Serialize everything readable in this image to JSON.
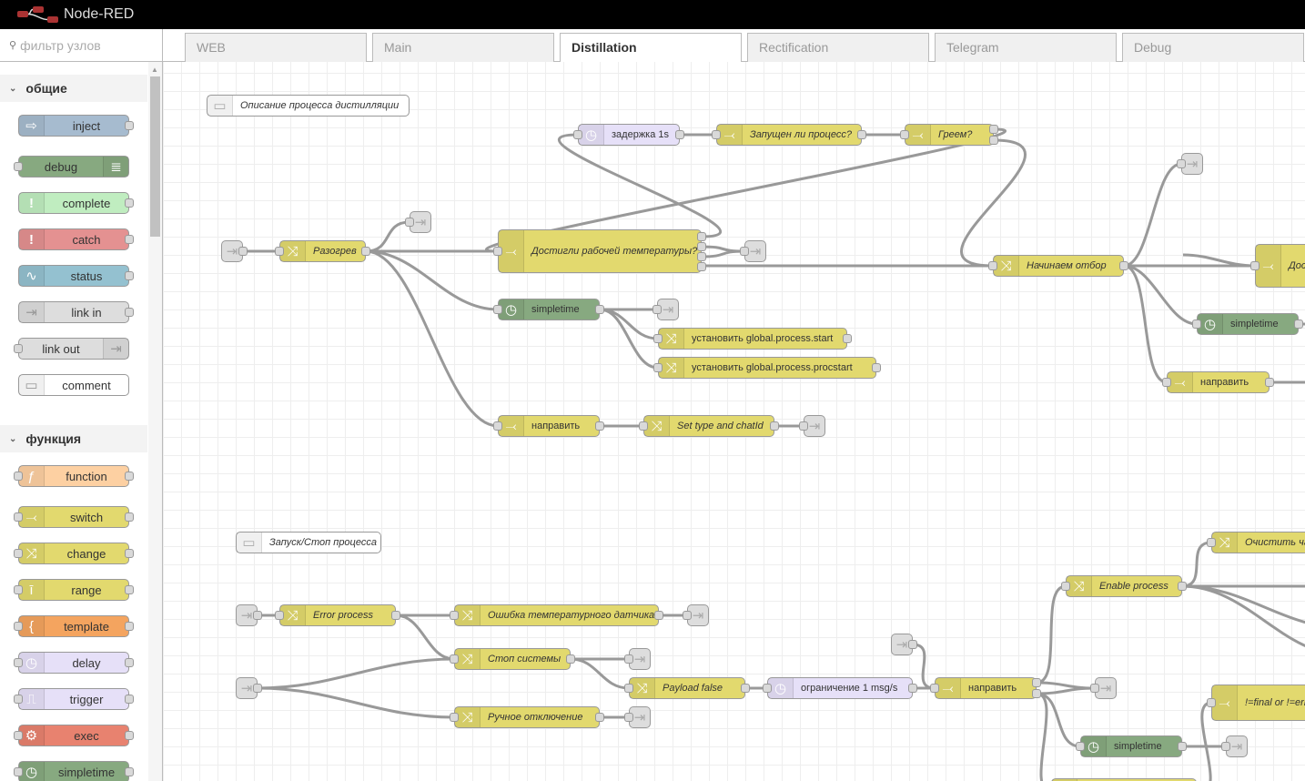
{
  "header": {
    "title": "Node-RED",
    "logo_icon": "node-red-logo"
  },
  "palette": {
    "filter_placeholder": "фильтр узлов",
    "categories": [
      {
        "title": "общие",
        "nodes": [
          {
            "label": "inject",
            "type": "inject"
          },
          {
            "label": "debug",
            "type": "debug"
          },
          {
            "label": "complete",
            "type": "complete"
          },
          {
            "label": "catch",
            "type": "catch"
          },
          {
            "label": "status",
            "type": "status"
          },
          {
            "label": "link in",
            "type": "linkin"
          },
          {
            "label": "link out",
            "type": "linkout"
          },
          {
            "label": "comment",
            "type": "comment"
          }
        ]
      },
      {
        "title": "функция",
        "nodes": [
          {
            "label": "function",
            "type": "function"
          },
          {
            "label": "switch",
            "type": "switch"
          },
          {
            "label": "change",
            "type": "change"
          },
          {
            "label": "range",
            "type": "range"
          },
          {
            "label": "template",
            "type": "template"
          },
          {
            "label": "delay",
            "type": "delay"
          },
          {
            "label": "trigger",
            "type": "trigger"
          },
          {
            "label": "exec",
            "type": "exec"
          },
          {
            "label": "simpletime",
            "type": "simpletime"
          }
        ]
      }
    ]
  },
  "tabs": [
    {
      "label": "WEB"
    },
    {
      "label": "Main"
    },
    {
      "label": "Distillation",
      "active": true
    },
    {
      "label": "Rectification"
    },
    {
      "label": "Telegram"
    },
    {
      "label": "Debug"
    }
  ],
  "colors": {
    "inject": "#a6bbcf",
    "debug": "#87a980",
    "complete": "#c0edc0",
    "catch": "#e49191",
    "status": "#94c1d0",
    "linkin": "#dddddd",
    "linkout": "#dddddd",
    "link": "#dddddd",
    "comment": "#ffffff",
    "function": "#fdd0a2",
    "switch": "#e2d96e",
    "change": "#e2d96e",
    "range": "#e2d96e",
    "template": "#f4a45f",
    "delay": "#e6e0f8",
    "trigger": "#e6e0f8",
    "exec": "#e8826f",
    "simpletime": "#87a980"
  },
  "icons": {
    "inject": "arrow-in-icon",
    "debug": "list-icon",
    "complete": "alert-icon",
    "catch": "alert-icon",
    "status": "pulse-icon",
    "linkin": "link-in-icon",
    "linkout": "link-out-icon",
    "link": "link-icon",
    "comment": "comment-icon",
    "function": "function-icon",
    "switch": "switch-icon",
    "change": "shuffle-icon",
    "range": "range-icon",
    "template": "template-icon",
    "delay": "timer-icon",
    "trigger": "trigger-icon",
    "exec": "cog-icon",
    "simpletime": "clock-icon"
  },
  "flow": {
    "nodes": [
      {
        "label": "Описание процесса дистилляции",
        "type": "comment"
      },
      {
        "label": "",
        "type": "link"
      },
      {
        "label": "Разогрев",
        "type": "change"
      },
      {
        "label": "",
        "type": "link"
      },
      {
        "label": "задержка 1s",
        "type": "delay"
      },
      {
        "label": "Запущен ли процесс?",
        "type": "switch"
      },
      {
        "label": "Греем?",
        "type": "switch"
      },
      {
        "label": "Достигли рабочей температуры?",
        "type": "switch"
      },
      {
        "label": "",
        "type": "link"
      },
      {
        "label": "Начинаем отбор",
        "type": "change"
      },
      {
        "label": "",
        "type": "link"
      },
      {
        "label": "Дости",
        "type": "switch"
      },
      {
        "label": "simpletime",
        "type": "simpletime"
      },
      {
        "label": "направить",
        "type": "switch"
      },
      {
        "label": "simpletime",
        "type": "simpletime"
      },
      {
        "label": "",
        "type": "link"
      },
      {
        "label": "установить global.process.start",
        "type": "change"
      },
      {
        "label": "установить global.process.procstart",
        "type": "change"
      },
      {
        "label": "направить",
        "type": "switch"
      },
      {
        "label": "Set type and chatId",
        "type": "change"
      },
      {
        "label": "",
        "type": "link"
      },
      {
        "label": "Запуск/Стоп процесса",
        "type": "comment"
      },
      {
        "label": "",
        "type": "link"
      },
      {
        "label": "Error process",
        "type": "change"
      },
      {
        "label": "Ошибка температурного датчика",
        "type": "change"
      },
      {
        "label": "",
        "type": "link"
      },
      {
        "label": "Стоп системы",
        "type": "change"
      },
      {
        "label": "",
        "type": "link"
      },
      {
        "label": "",
        "type": "link"
      },
      {
        "label": "Payload false",
        "type": "change"
      },
      {
        "label": "ограничение 1 msg/s",
        "type": "delay"
      },
      {
        "label": "",
        "type": "link"
      },
      {
        "label": "направить",
        "type": "switch"
      },
      {
        "label": "",
        "type": "link"
      },
      {
        "label": "Ручное отключение",
        "type": "change"
      },
      {
        "label": "",
        "type": "link"
      },
      {
        "label": "Enable process",
        "type": "change"
      },
      {
        "label": "Очистить ча",
        "type": "change"
      },
      {
        "label": "!=final or !=erro",
        "type": "switch"
      },
      {
        "label": "simpletime",
        "type": "simpletime"
      },
      {
        "label": "",
        "type": "link"
      },
      {
        "label": "",
        "type": "change"
      }
    ]
  }
}
